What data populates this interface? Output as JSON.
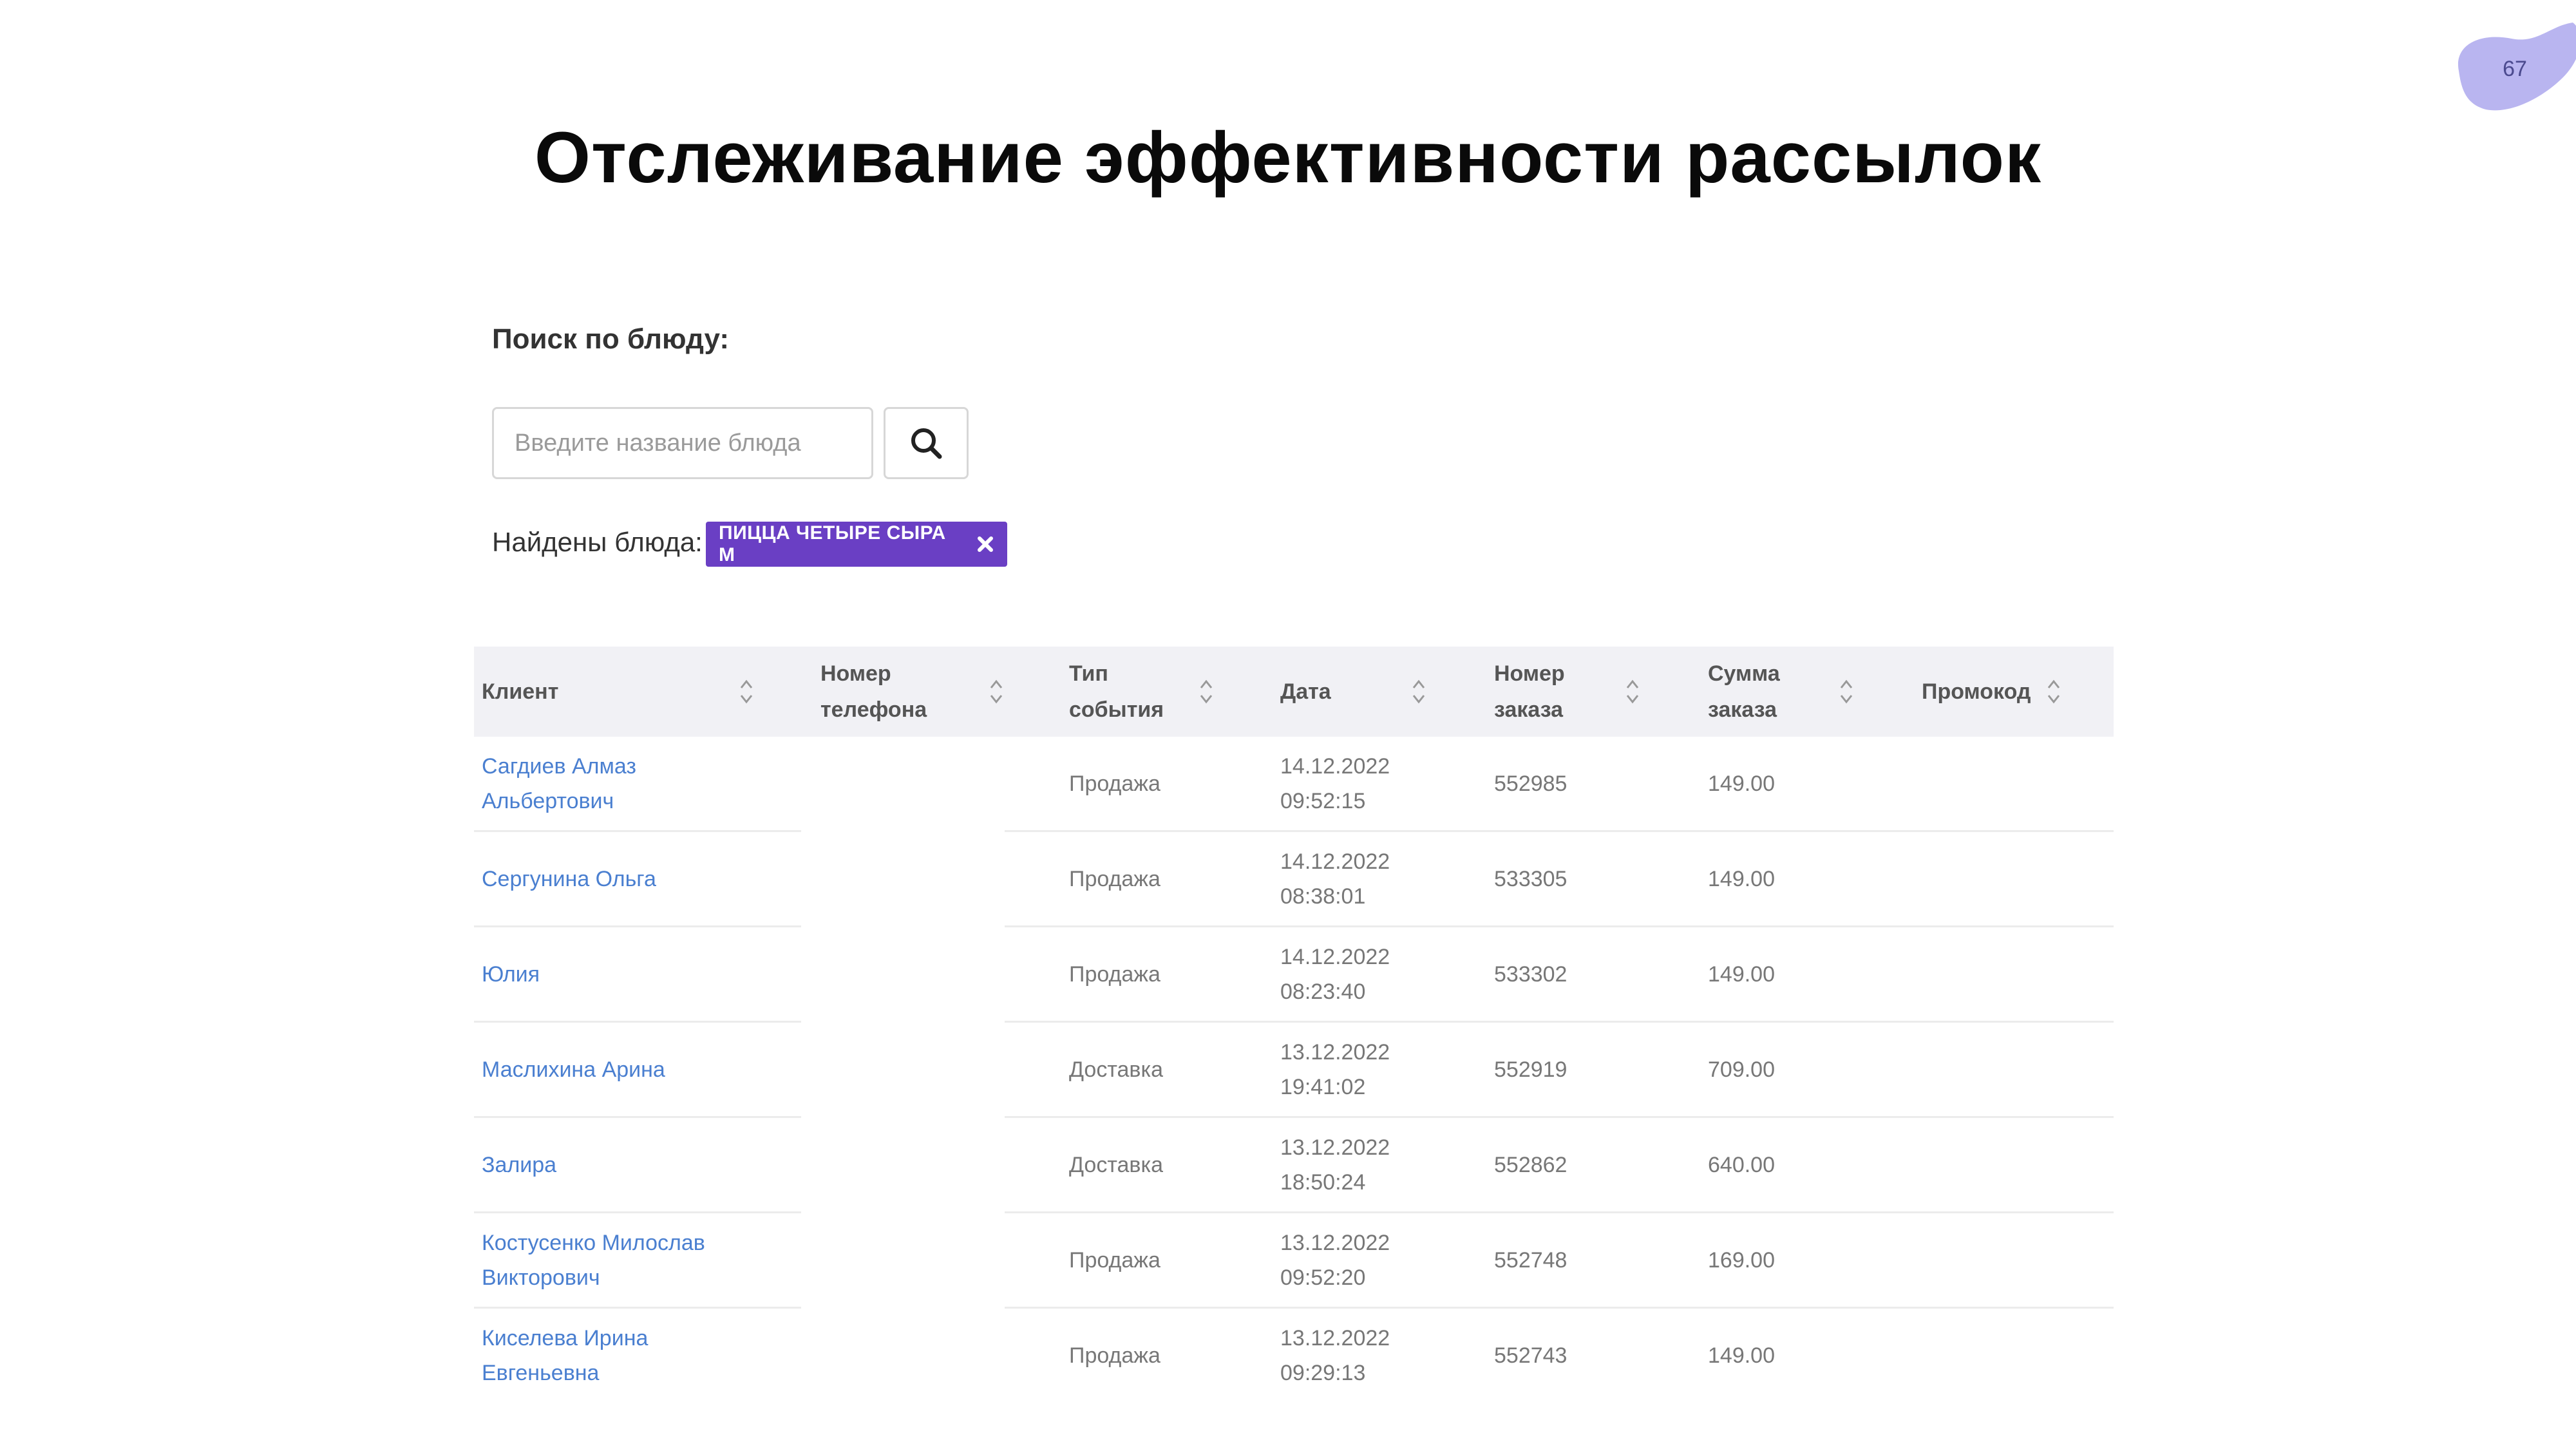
{
  "page": {
    "number": "67",
    "title": "Отслеживание эффективности рассылок"
  },
  "colors": {
    "accent": "#6a3fc4",
    "blob": "#b9b5f0",
    "link": "#4a7fd0",
    "header_bg": "#f1f1f5"
  },
  "search": {
    "label": "Поиск по блюду:",
    "value": "",
    "placeholder": "Введите название блюда",
    "button_icon": "search-icon"
  },
  "found": {
    "label": "Найдены блюда:",
    "tags": [
      {
        "label": "ПИЦЦА ЧЕТЫРЕ СЫРА М",
        "icon": "close-icon"
      }
    ]
  },
  "table": {
    "columns": [
      {
        "label": "Клиент",
        "sortable": true
      },
      {
        "label": "Номер\nтелефона",
        "sortable": true
      },
      {
        "label": "Тип\nсобытия",
        "sortable": true
      },
      {
        "label": "Дата",
        "sortable": true
      },
      {
        "label": "Номер\nзаказа",
        "sortable": true
      },
      {
        "label": "Сумма\nзаказа",
        "sortable": true
      },
      {
        "label": "Промокод",
        "sortable": true
      }
    ],
    "rows": [
      {
        "client": "Сагдиев Алмаз\nАльбертович",
        "phone": "",
        "event": "Продажа",
        "date": "14.12.2022\n09:52:15",
        "order": "552985",
        "amount": "149.00",
        "promo": ""
      },
      {
        "client": "Сергунина Ольга",
        "phone": "",
        "event": "Продажа",
        "date": "14.12.2022\n08:38:01",
        "order": "533305",
        "amount": "149.00",
        "promo": ""
      },
      {
        "client": "Юлия",
        "phone": "",
        "event": "Продажа",
        "date": "14.12.2022\n08:23:40",
        "order": "533302",
        "amount": "149.00",
        "promo": ""
      },
      {
        "client": "Маслихина Арина",
        "phone": "",
        "event": "Доставка",
        "date": "13.12.2022\n19:41:02",
        "order": "552919",
        "amount": "709.00",
        "promo": ""
      },
      {
        "client": "Залира",
        "phone": "",
        "event": "Доставка",
        "date": "13.12.2022\n18:50:24",
        "order": "552862",
        "amount": "640.00",
        "promo": ""
      },
      {
        "client": "Костусенко Милослав\nВикторович",
        "phone": "",
        "event": "Продажа",
        "date": "13.12.2022\n09:52:20",
        "order": "552748",
        "amount": "169.00",
        "promo": ""
      },
      {
        "client": "Киселева Ирина\nЕвгеньевна",
        "phone": "",
        "event": "Продажа",
        "date": "13.12.2022\n09:29:13",
        "order": "552743",
        "amount": "149.00",
        "promo": ""
      }
    ]
  }
}
